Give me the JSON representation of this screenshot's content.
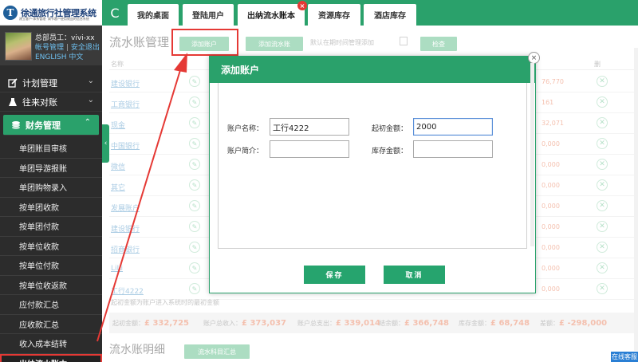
{
  "app": {
    "logo_mark": "T",
    "title": "徐通旅行社管理系统",
    "subtitle": "建立客户·体系管理· 调节客户使用效益的信息系统"
  },
  "user": {
    "line1": "总部员工：vivi-xx",
    "account_link": "帐号管理",
    "separator": "|",
    "logout_link": "安全退出",
    "lang_en": "ENGLISH",
    "lang_zh": "中文"
  },
  "sidebar": {
    "groups": [
      {
        "label": "计划管理",
        "chevron": "⌄"
      },
      {
        "label": "往来对账",
        "chevron": "⌄"
      },
      {
        "label": "财务管理",
        "chevron": "⌃"
      }
    ],
    "items": [
      "单团账目审核",
      "单团导游报账",
      "单团购物录入",
      "按单团收款",
      "按单团付款",
      "按单位收款",
      "按单位付款",
      "按单位收返款",
      "应付款汇总",
      "应收款汇总",
      "收入成本结转",
      "出纳流水账本"
    ],
    "collapse_icon": "‹"
  },
  "tabs": [
    {
      "label": "我的桌面"
    },
    {
      "label": "登陆用户"
    },
    {
      "label": "出纳流水账本"
    },
    {
      "label": "资源库存"
    },
    {
      "label": "酒店库存"
    }
  ],
  "tab_close_icon": "×",
  "refresh_icon": "C",
  "main": {
    "page_title": "流水账管理",
    "btn_add_account": "添加账户",
    "btn_add_flow": "添加流水账",
    "hint": "默认在期时间管理添加",
    "btn_confirm": "检查",
    "col_name": "名称",
    "col_del": "删",
    "rows": [
      {
        "name": "建设银行",
        "amount": "76,770"
      },
      {
        "name": "工商银行",
        "amount": "161"
      },
      {
        "name": "现金",
        "amount": "32,071"
      },
      {
        "name": "中国银行",
        "amount": "0,000"
      },
      {
        "name": "微信",
        "amount": "0,000"
      },
      {
        "name": "其它",
        "amount": "0,000"
      },
      {
        "name": "发展账户",
        "amount": "0,000"
      },
      {
        "name": "建设银行",
        "amount": "0,000"
      },
      {
        "name": "招商银行",
        "amount": "0,000"
      },
      {
        "name": "LiLi",
        "amount": "0,000"
      },
      {
        "name": "工行4222",
        "amount": "0,000"
      }
    ],
    "note": "起初金额为账户进入系统时的最初金额",
    "summary": [
      {
        "label": "起初金额：",
        "value": "£ 332,725"
      },
      {
        "label": "账户总收入：",
        "value": "£ 373,037"
      },
      {
        "label": "账户总支出：",
        "value": "£ 339,014"
      },
      {
        "label": "结余额：",
        "value": "£ 366,748"
      },
      {
        "label": "库存金额：",
        "value": "£ 68,748"
      },
      {
        "label": "差额：",
        "value": "£ -298,000"
      }
    ],
    "sub_title": "流水账明细",
    "btn_flow_summary": "流水科目汇总"
  },
  "modal": {
    "title": "添加账户",
    "close_icon": "×",
    "fields": {
      "account_name_label": "账户名称：",
      "account_name_value": "工行4222",
      "initial_amount_label": "起初金额：",
      "initial_amount_value": "2000",
      "account_intro_label": "账户简介：",
      "account_intro_value": "",
      "stock_amount_label": "库存金额：",
      "stock_amount_value": ""
    },
    "save_label": "保存",
    "cancel_label": "取消"
  },
  "online_service": "在线客服",
  "colors": {
    "accent": "#2aa16b",
    "sidebar_bg": "#2c2c2c",
    "annotation": "#e53935"
  }
}
